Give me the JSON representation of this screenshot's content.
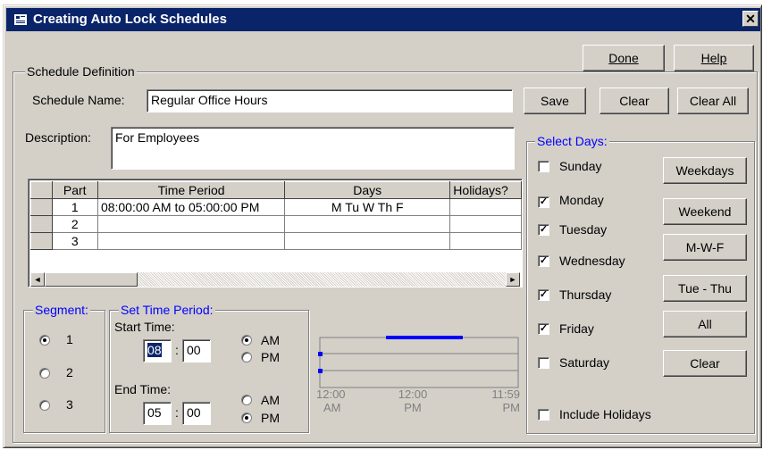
{
  "window": {
    "title": "Creating Auto Lock Schedules",
    "close_glyph": "✕"
  },
  "top_buttons": {
    "done": "Done",
    "help": "Help"
  },
  "schedule_definition": {
    "legend": "Schedule Definition",
    "name_label": "Schedule Name:",
    "name_value": "Regular Office Hours",
    "description_label": "Description:",
    "description_value": "For Employees"
  },
  "action_buttons": {
    "save": "Save",
    "clear": "Clear",
    "clear_all": "Clear All"
  },
  "table": {
    "headers": [
      "",
      "Part",
      "Time Period",
      "Days",
      "Holidays?"
    ],
    "rows": [
      {
        "part": "1",
        "time_period": "08:00:00 AM to 05:00:00 PM",
        "days": "M Tu W Th F",
        "holidays": ""
      },
      {
        "part": "2",
        "time_period": "",
        "days": "",
        "holidays": ""
      },
      {
        "part": "3",
        "time_period": "",
        "days": "",
        "holidays": ""
      }
    ],
    "scroll_left": "◄",
    "scroll_right": "►"
  },
  "segment": {
    "legend": "Segment:",
    "options": [
      "1",
      "2",
      "3"
    ],
    "selected": "1"
  },
  "time_period": {
    "legend": "Set Time Period:",
    "start_label": "Start Time:",
    "start_hour": "08",
    "start_minute": "00",
    "start_ampm": "AM",
    "end_label": "End Time:",
    "end_hour": "05",
    "end_minute": "00",
    "end_ampm": "PM",
    "colon": ":",
    "am": "AM",
    "pm": "PM"
  },
  "timeline": {
    "tick_labels": [
      {
        "time": "12:00",
        "ampm": "AM"
      },
      {
        "time": "12:00",
        "ampm": "PM"
      },
      {
        "time": "11:59",
        "ampm": "PM"
      }
    ],
    "bar_color": "#0000ff"
  },
  "select_days": {
    "legend": "Select Days:",
    "days": [
      {
        "label": "Sunday",
        "checked": false
      },
      {
        "label": "Monday",
        "checked": true
      },
      {
        "label": "Tuesday",
        "checked": true
      },
      {
        "label": "Wednesday",
        "checked": true
      },
      {
        "label": "Thursday",
        "checked": true
      },
      {
        "label": "Friday",
        "checked": true
      },
      {
        "label": "Saturday",
        "checked": false
      }
    ],
    "preset_buttons": [
      "Weekdays",
      "Weekend",
      "M-W-F",
      "Tue - Thu",
      "All",
      "Clear"
    ],
    "include_holidays_label": "Include Holidays",
    "include_holidays_checked": false,
    "check_glyph": "✓"
  },
  "colors": {
    "title_bar": "#0a246a",
    "face": "#d4d0c8",
    "accent_blue": "#0000ff"
  }
}
